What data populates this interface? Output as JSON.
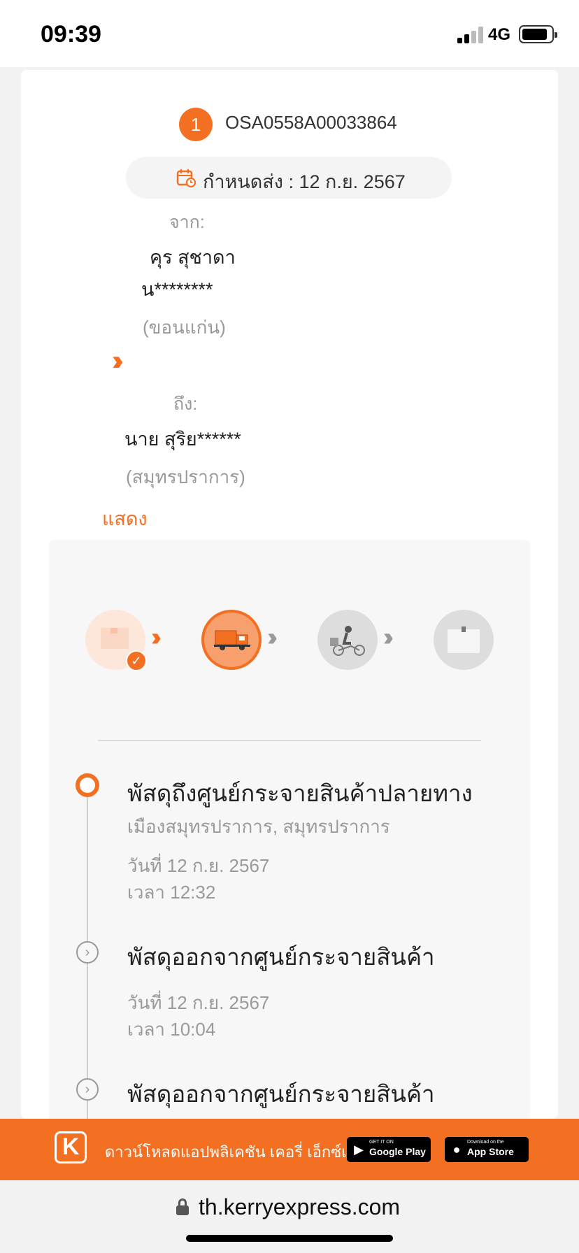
{
  "status_bar": {
    "time": "09:39",
    "network": "4G"
  },
  "shipment": {
    "index": "1",
    "tracking_number": "OSA0558A00033864",
    "due_label": "กำหนดส่ง : 12 ก.ย. 2567",
    "from_label": "จาก:",
    "sender_name": "คุร สุชาดา",
    "sender_masked": "น********",
    "sender_province": "(ขอนแก่น)",
    "to_label": "ถึง:",
    "receiver_name": "นาย สุริย******",
    "receiver_province": "(สมุทรปราการ)",
    "show_link": "แสดง"
  },
  "progress": {
    "steps": [
      "parcel-received",
      "in-transit-truck",
      "courier-delivery",
      "delivered-box"
    ],
    "current_step": 2
  },
  "events": [
    {
      "title": "พัสดุถึงศูนย์กระจายสินค้าปลายทาง",
      "location": "เมืองสมุทรปราการ, สมุทรปราการ",
      "date": "วันที่ 12 ก.ย. 2567",
      "time": "เวลา 12:32"
    },
    {
      "title": "พัสดุออกจากศูนย์กระจายสินค้า",
      "date": "วันที่ 12 ก.ย. 2567",
      "time": "เวลา 10:04"
    },
    {
      "title": "พัสดุออกจากศูนย์กระจายสินค้า"
    }
  ],
  "banner": {
    "logo": "K",
    "text": "ดาวน์โหลดแอปพลิเคชัน เคอรี่ เอ็กซ์เพรส",
    "google_small": "GET IT ON",
    "google_big": "Google Play",
    "apple_small": "Download on the",
    "apple_big": "App Store"
  },
  "browser": {
    "url": "th.kerryexpress.com"
  },
  "colors": {
    "accent": "#f36f21",
    "muted": "#999999"
  }
}
